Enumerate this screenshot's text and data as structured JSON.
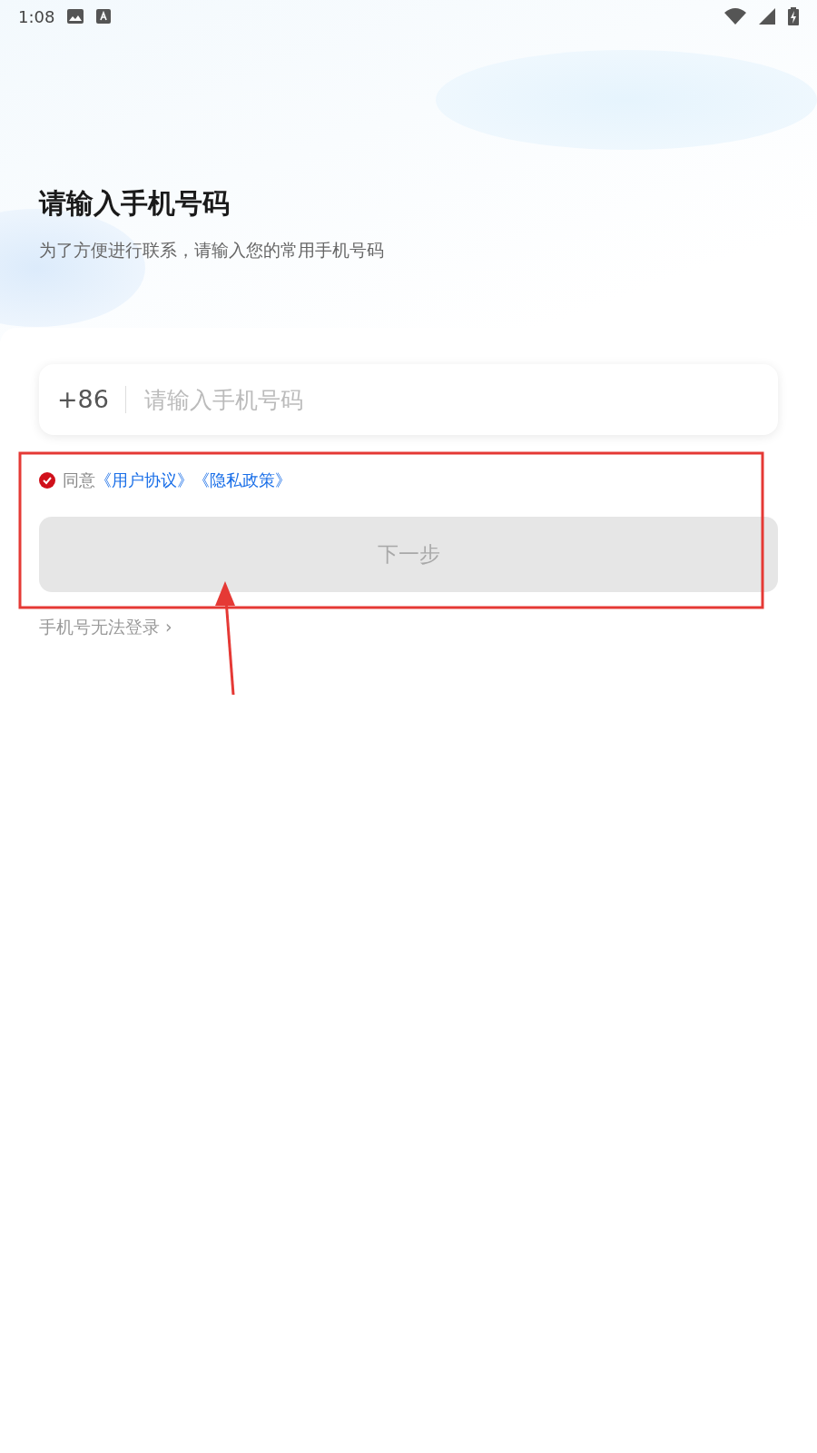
{
  "status_bar": {
    "time": "1:08"
  },
  "title": "请输入手机号码",
  "subtitle": "为了方便进行联系，请输入您的常用手机号码",
  "phone_field": {
    "country_code": "+86",
    "placeholder": "请输入手机号码"
  },
  "agreement": {
    "checked": true,
    "label": "同意",
    "links": [
      "《用户协议》",
      "《隐私政策》"
    ]
  },
  "next_button": {
    "label": "下一步",
    "disabled": true
  },
  "help_link": {
    "label": "手机号无法登录",
    "chevron": "›"
  }
}
